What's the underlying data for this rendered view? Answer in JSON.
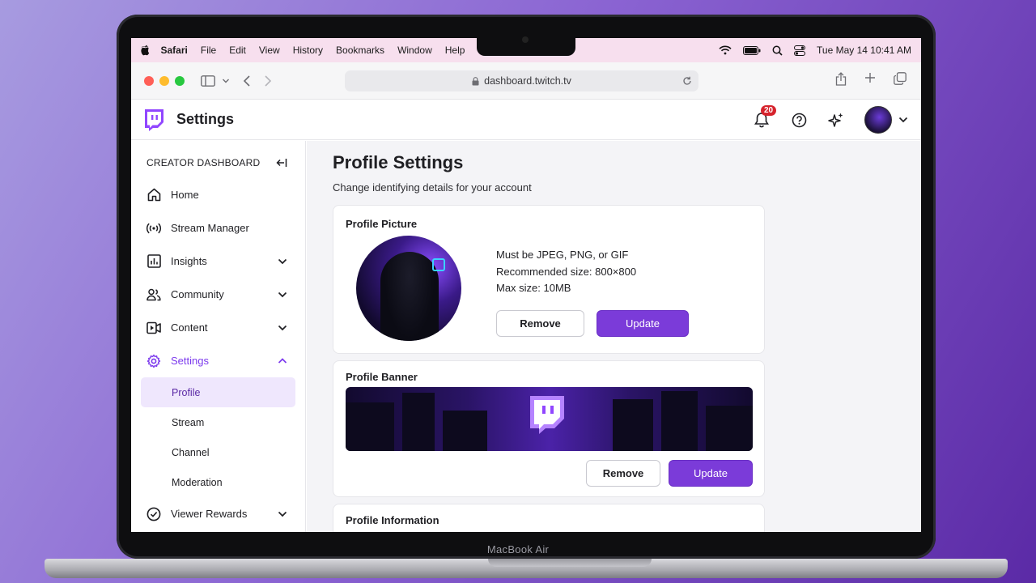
{
  "menubar": {
    "app": "Safari",
    "items": [
      "File",
      "Edit",
      "View",
      "History",
      "Bookmarks",
      "Window",
      "Help"
    ],
    "clock": "Tue May 14  10:41 AM"
  },
  "browser": {
    "url": "dashboard.twitch.tv"
  },
  "header": {
    "title": "Settings",
    "notification_count": "20"
  },
  "sidebar": {
    "heading": "CREATOR DASHBOARD",
    "items": [
      {
        "label": "Home",
        "icon": "home-icon"
      },
      {
        "label": "Stream Manager",
        "icon": "broadcast-icon"
      },
      {
        "label": "Insights",
        "icon": "chart-icon"
      },
      {
        "label": "Community",
        "icon": "people-icon"
      },
      {
        "label": "Content",
        "icon": "video-icon"
      },
      {
        "label": "Settings",
        "icon": "gear-icon"
      }
    ],
    "settings_sub": [
      "Profile",
      "Stream",
      "Channel",
      "Moderation"
    ],
    "last_item": {
      "label": "Viewer Rewards",
      "icon": "check-circle-icon"
    }
  },
  "main": {
    "title": "Profile Settings",
    "subtitle": "Change identifying details for your account",
    "profile_picture": {
      "title": "Profile Picture",
      "info": [
        "Must be JPEG, PNG, or GIF",
        "Recommended size: 800×800",
        "Max size: 10MB"
      ],
      "remove_label": "Remove",
      "update_label": "Update"
    },
    "profile_banner": {
      "title": "Profile Banner",
      "remove_label": "Remove",
      "update_label": "Update"
    },
    "profile_information": {
      "title": "Profile Information"
    }
  },
  "device": {
    "label": "MacBook Air"
  },
  "colors": {
    "accent": "#7b3bd9",
    "badge": "#d6232c",
    "menubar": "#f7dfee"
  }
}
